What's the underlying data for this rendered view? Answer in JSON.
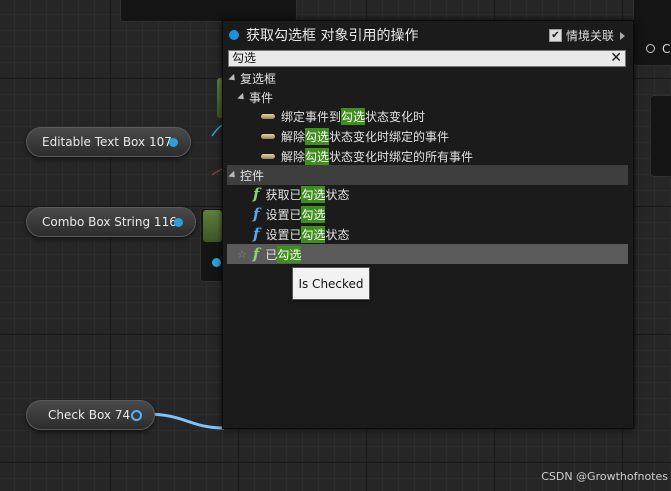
{
  "popup": {
    "title": "获取勾选框 对象引用的操作",
    "context_label": "情境关联",
    "context_checked": "✔",
    "search_value": "勾选",
    "clear_symbol": "✕"
  },
  "tree": {
    "category_checkbox": "复选框",
    "subcategory_event": "事件",
    "events": [
      {
        "pre": "绑定事件到",
        "hl": "勾选",
        "post": "状态变化时"
      },
      {
        "pre": "解除",
        "hl": "勾选",
        "post": "状态变化时绑定的事件"
      },
      {
        "pre": "解除",
        "hl": "勾选",
        "post": "状态变化时绑定的所有事件"
      }
    ],
    "category_widget": "控件",
    "functions": [
      {
        "pre": "获取已",
        "hl": "勾选",
        "post": "状态"
      },
      {
        "pre": "设置已",
        "hl": "勾选",
        "post": ""
      },
      {
        "pre": "设置已",
        "hl": "勾选",
        "post": "状态"
      },
      {
        "pre": "已",
        "hl": "勾选",
        "post": ""
      }
    ]
  },
  "tooltip": "Is Checked",
  "nodes": {
    "editable_text_box": "Editable Text Box 107",
    "combo_box_string": "Combo Box String 116",
    "check_box": "Check Box 74",
    "right_partial": "C"
  },
  "watermark": "CSDN @Growthofnotes",
  "colors": {
    "highlight": "#3f8f1e",
    "pin": "#2ea0d8",
    "wire": "#7ec3ff"
  }
}
